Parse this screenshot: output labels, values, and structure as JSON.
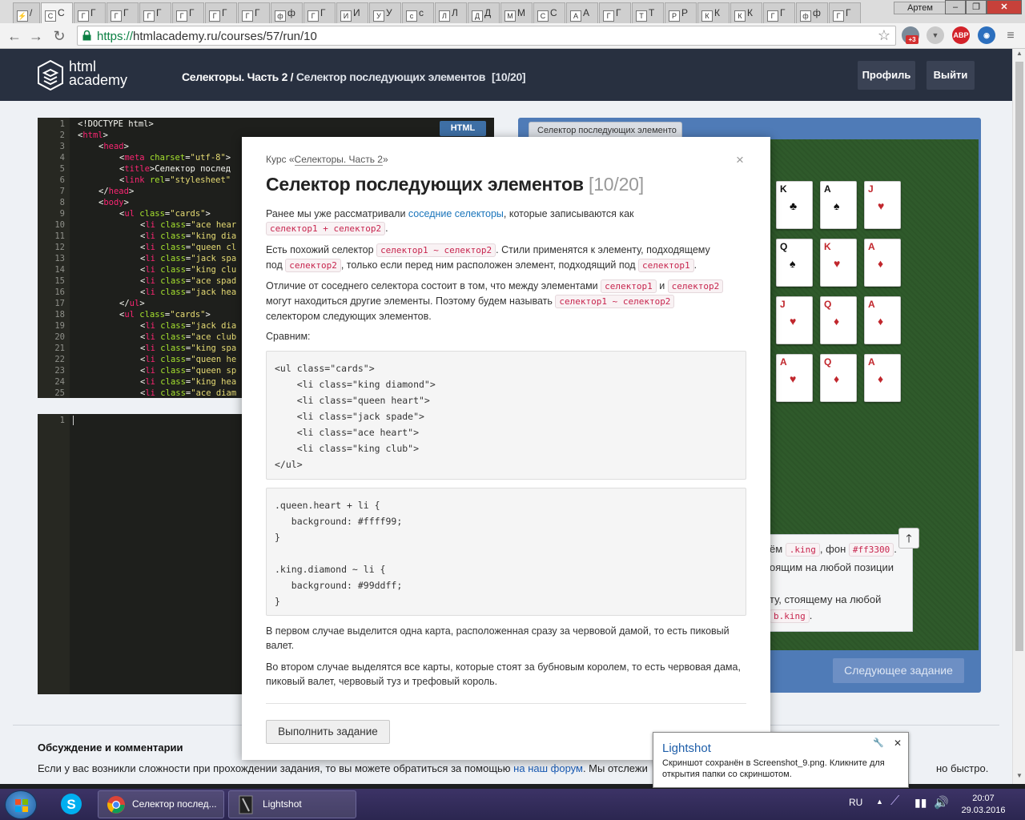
{
  "browser": {
    "tabs": [
      {
        "fav": "⚡",
        "label": "/"
      },
      {
        "fav": "С",
        "label": "С"
      },
      {
        "fav": "Г",
        "label": "Г"
      },
      {
        "fav": "Г",
        "label": "Г"
      },
      {
        "fav": "Г",
        "label": "Г"
      },
      {
        "fav": "Г",
        "label": "Г"
      },
      {
        "fav": "Г",
        "label": "Г"
      },
      {
        "fav": "Г",
        "label": "Г"
      },
      {
        "fav": "ф",
        "label": "ф"
      },
      {
        "fav": "Г",
        "label": "Г"
      },
      {
        "fav": "И",
        "label": "И"
      },
      {
        "fav": "У",
        "label": "У"
      },
      {
        "fav": "с",
        "label": "с"
      },
      {
        "fav": "Л",
        "label": "Л"
      },
      {
        "fav": "Д",
        "label": "Д"
      },
      {
        "fav": "М",
        "label": "М"
      },
      {
        "fav": "С",
        "label": "С"
      },
      {
        "fav": "А",
        "label": "А"
      },
      {
        "fav": "Г",
        "label": "Г"
      },
      {
        "fav": "Т",
        "label": "Т"
      },
      {
        "fav": "Р",
        "label": "Р"
      },
      {
        "fav": "К",
        "label": "К"
      },
      {
        "fav": "К",
        "label": "К"
      },
      {
        "fav": "Г",
        "label": "Г"
      },
      {
        "fav": "ф",
        "label": "ф"
      },
      {
        "fav": "Г",
        "label": "Г"
      }
    ],
    "user": "Артем",
    "url_scheme": "https://",
    "url_rest": "htmlacademy.ru/courses/57/run/10",
    "ext_badge": "+3",
    "abp": "ABP"
  },
  "site": {
    "logo_line1": "html",
    "logo_line2": "academy",
    "course": "Селекторы. Часть 2",
    "separator": " / ",
    "lesson": "Селектор последующих элементов",
    "counter": "[10/20]",
    "profile_btn": "Профиль",
    "logout_btn": "Выйти"
  },
  "editor": {
    "badge": "HTML",
    "lines": [
      {
        "n": "1",
        "indent": 0,
        "parts": [
          [
            "txt",
            "<!DOCTYPE html>"
          ]
        ]
      },
      {
        "n": "2",
        "indent": 0,
        "parts": [
          [
            "txt",
            "<"
          ],
          [
            "tg",
            "html"
          ],
          [
            "txt",
            ">"
          ]
        ]
      },
      {
        "n": "3",
        "indent": 1,
        "parts": [
          [
            "txt",
            "<"
          ],
          [
            "tg",
            "head"
          ],
          [
            "txt",
            ">"
          ]
        ]
      },
      {
        "n": "4",
        "indent": 2,
        "parts": [
          [
            "txt",
            "<"
          ],
          [
            "tg",
            "meta"
          ],
          [
            "at",
            " charset"
          ],
          [
            "txt",
            "="
          ],
          [
            "st",
            "\"utf-8\""
          ],
          [
            "txt",
            ">"
          ]
        ]
      },
      {
        "n": "5",
        "indent": 2,
        "parts": [
          [
            "txt",
            "<"
          ],
          [
            "tg",
            "title"
          ],
          [
            "txt",
            ">Селектор послед"
          ]
        ]
      },
      {
        "n": "6",
        "indent": 2,
        "parts": [
          [
            "txt",
            "<"
          ],
          [
            "tg",
            "link"
          ],
          [
            "at",
            " rel"
          ],
          [
            "txt",
            "="
          ],
          [
            "st",
            "\"stylesheet\""
          ]
        ]
      },
      {
        "n": "7",
        "indent": 1,
        "parts": [
          [
            "txt",
            "</"
          ],
          [
            "tg",
            "head"
          ],
          [
            "txt",
            ">"
          ]
        ]
      },
      {
        "n": "8",
        "indent": 1,
        "parts": [
          [
            "txt",
            "<"
          ],
          [
            "tg",
            "body"
          ],
          [
            "txt",
            ">"
          ]
        ]
      },
      {
        "n": "9",
        "indent": 2,
        "parts": [
          [
            "txt",
            "<"
          ],
          [
            "tg",
            "ul"
          ],
          [
            "at",
            " class"
          ],
          [
            "txt",
            "="
          ],
          [
            "st",
            "\"cards\""
          ],
          [
            "txt",
            ">"
          ]
        ]
      },
      {
        "n": "10",
        "indent": 3,
        "parts": [
          [
            "txt",
            "<"
          ],
          [
            "tg",
            "li"
          ],
          [
            "at",
            " class"
          ],
          [
            "txt",
            "="
          ],
          [
            "st",
            "\"ace hear"
          ]
        ]
      },
      {
        "n": "11",
        "indent": 3,
        "parts": [
          [
            "txt",
            "<"
          ],
          [
            "tg",
            "li"
          ],
          [
            "at",
            " class"
          ],
          [
            "txt",
            "="
          ],
          [
            "st",
            "\"king dia"
          ]
        ]
      },
      {
        "n": "12",
        "indent": 3,
        "parts": [
          [
            "txt",
            "<"
          ],
          [
            "tg",
            "li"
          ],
          [
            "at",
            " class"
          ],
          [
            "txt",
            "="
          ],
          [
            "st",
            "\"queen cl"
          ]
        ]
      },
      {
        "n": "13",
        "indent": 3,
        "parts": [
          [
            "txt",
            "<"
          ],
          [
            "tg",
            "li"
          ],
          [
            "at",
            " class"
          ],
          [
            "txt",
            "="
          ],
          [
            "st",
            "\"jack spa"
          ]
        ]
      },
      {
        "n": "14",
        "indent": 3,
        "parts": [
          [
            "txt",
            "<"
          ],
          [
            "tg",
            "li"
          ],
          [
            "at",
            " class"
          ],
          [
            "txt",
            "="
          ],
          [
            "st",
            "\"king clu"
          ]
        ]
      },
      {
        "n": "15",
        "indent": 3,
        "parts": [
          [
            "txt",
            "<"
          ],
          [
            "tg",
            "li"
          ],
          [
            "at",
            " class"
          ],
          [
            "txt",
            "="
          ],
          [
            "st",
            "\"ace spad"
          ]
        ]
      },
      {
        "n": "16",
        "indent": 3,
        "parts": [
          [
            "txt",
            "<"
          ],
          [
            "tg",
            "li"
          ],
          [
            "at",
            " class"
          ],
          [
            "txt",
            "="
          ],
          [
            "st",
            "\"jack hea"
          ]
        ]
      },
      {
        "n": "17",
        "indent": 2,
        "parts": [
          [
            "txt",
            "</"
          ],
          [
            "tg",
            "ul"
          ],
          [
            "txt",
            ">"
          ]
        ]
      },
      {
        "n": "18",
        "indent": 2,
        "parts": [
          [
            "txt",
            "<"
          ],
          [
            "tg",
            "ul"
          ],
          [
            "at",
            " class"
          ],
          [
            "txt",
            "="
          ],
          [
            "st",
            "\"cards\""
          ],
          [
            "txt",
            ">"
          ]
        ]
      },
      {
        "n": "19",
        "indent": 3,
        "parts": [
          [
            "txt",
            "<"
          ],
          [
            "tg",
            "li"
          ],
          [
            "at",
            " class"
          ],
          [
            "txt",
            "="
          ],
          [
            "st",
            "\"jack dia"
          ]
        ]
      },
      {
        "n": "20",
        "indent": 3,
        "parts": [
          [
            "txt",
            "<"
          ],
          [
            "tg",
            "li"
          ],
          [
            "at",
            " class"
          ],
          [
            "txt",
            "="
          ],
          [
            "st",
            "\"ace club"
          ]
        ]
      },
      {
        "n": "21",
        "indent": 3,
        "parts": [
          [
            "txt",
            "<"
          ],
          [
            "tg",
            "li"
          ],
          [
            "at",
            " class"
          ],
          [
            "txt",
            "="
          ],
          [
            "st",
            "\"king spa"
          ]
        ]
      },
      {
        "n": "22",
        "indent": 3,
        "parts": [
          [
            "txt",
            "<"
          ],
          [
            "tg",
            "li"
          ],
          [
            "at",
            " class"
          ],
          [
            "txt",
            "="
          ],
          [
            "st",
            "\"queen he"
          ]
        ]
      },
      {
        "n": "23",
        "indent": 3,
        "parts": [
          [
            "txt",
            "<"
          ],
          [
            "tg",
            "li"
          ],
          [
            "at",
            " class"
          ],
          [
            "txt",
            "="
          ],
          [
            "st",
            "\"queen sp"
          ]
        ]
      },
      {
        "n": "24",
        "indent": 3,
        "parts": [
          [
            "txt",
            "<"
          ],
          [
            "tg",
            "li"
          ],
          [
            "at",
            " class"
          ],
          [
            "txt",
            "="
          ],
          [
            "st",
            "\"king hea"
          ]
        ]
      },
      {
        "n": "25",
        "indent": 3,
        "parts": [
          [
            "txt",
            "<"
          ],
          [
            "tg",
            "li"
          ],
          [
            "at",
            " class"
          ],
          [
            "txt",
            "="
          ],
          [
            "st",
            "\"ace diam"
          ]
        ]
      }
    ],
    "css_line_number": "1"
  },
  "preview": {
    "tab_label": "Селектор последующих элементо",
    "cards": [
      {
        "rank": "K",
        "suit": "♣",
        "color": "black"
      },
      {
        "rank": "A",
        "suit": "♠",
        "color": "black"
      },
      {
        "rank": "J",
        "suit": "♥",
        "color": "red"
      },
      {
        "rank": "Q",
        "suit": "♠",
        "color": "black"
      },
      {
        "rank": "K",
        "suit": "♥",
        "color": "red"
      },
      {
        "rank": "A",
        "suit": "♦",
        "color": "red"
      },
      {
        "rank": "J",
        "suit": "♥",
        "color": "red"
      },
      {
        "rank": "Q",
        "suit": "♦",
        "color": "red"
      },
      {
        "rank": "A",
        "suit": "♦",
        "color": "red"
      },
      {
        "rank": "A",
        "suit": "♥",
        "color": "red"
      },
      {
        "rank": "Q",
        "suit": "♦",
        "color": "red"
      },
      {
        "rank": "A",
        "suit": "♦",
        "color": "red"
      }
    ],
    "hint_l1_a": "ём",
    "hint_l1_code": ".king",
    "hint_l1_b": ", фон",
    "hint_l1_code2": "#ff3300",
    "hint_l1_c": ".",
    "hint_l2": "оящим на любой позиции",
    "hint_l3": "ту, стоящему на любой",
    "hint_l4_code": "b.king",
    "hint_l4_end": ".",
    "up_icon": "🡑",
    "next_btn": "Следующее задание"
  },
  "discussion": {
    "title": "Обсуждение и комментарии",
    "text_before": "Если у вас возникли сложности при прохождении задания, то вы можете обратиться за помощью",
    "link": "на наш форум",
    "text_after": ". Мы отслежи",
    "text_tail": "но быстро."
  },
  "modal": {
    "course_prefix": "Курс «",
    "course_link": "Селекторы. Часть 2",
    "course_suffix": "»",
    "title": "Селектор последующих элементов",
    "counter": "[10/20]",
    "close": "×",
    "p1_a": "Ранее мы уже рассматривали ",
    "p1_link": "соседние селекторы",
    "p1_b": ", которые записываются как",
    "p1_code": "селектор1 + селектор2",
    "p1_end": ".",
    "p2_a": "Есть похожий селектор ",
    "p2_code1": "селектор1 ~ селектор2",
    "p2_b": ". Стили применятся к элементу, подходящему",
    "p2_c": "под ",
    "p2_code2": "селектор2",
    "p2_d": ", только если перед ним расположен элемент, подходящий под ",
    "p2_code3": "селектор1",
    "p2_end": ".",
    "p3_a": "Отличие от соседнего селектора состоит в том, что между элементами ",
    "p3_code1": "селектор1",
    "p3_and": " и ",
    "p3_code2": "селектор2",
    "p3_b": "могут находиться другие элементы. Поэтому будем называть ",
    "p3_code3": "селектор1 ~ селектор2",
    "p3_c": "селектором следующих элементов.",
    "compare": "Сравним:",
    "code1": "<ul class=\"cards\">\n    <li class=\"king diamond\">\n    <li class=\"queen heart\">\n    <li class=\"jack spade\">\n    <li class=\"ace heart\">\n    <li class=\"king club\">\n</ul>",
    "code2": ".queen.heart + li {\n   background: #ffff99;\n}\n\n.king.diamond ~ li {\n   background: #99ddff;\n}",
    "p4": "В первом случае выделится одна карта, расположенная сразу за червовой дамой, то есть пиковый валет.",
    "p5": "Во втором случае выделятся все карты, которые стоят за бубновым королем, то есть червовая дама, пиковый валет, червовый туз и трефовый король.",
    "run_btn": "Выполнить задание"
  },
  "toast": {
    "title": "Lightshot",
    "message": "Скриншот сохранён в Screenshot_9.png. Кликните для открытия папки со скриншотом.",
    "close": "✕",
    "tool": "🔧"
  },
  "taskbar": {
    "chrome_item": "Селектор послед...",
    "lightshot_item": "Lightshot",
    "lang": "RU",
    "time": "20:07",
    "date": "29.03.2016"
  }
}
